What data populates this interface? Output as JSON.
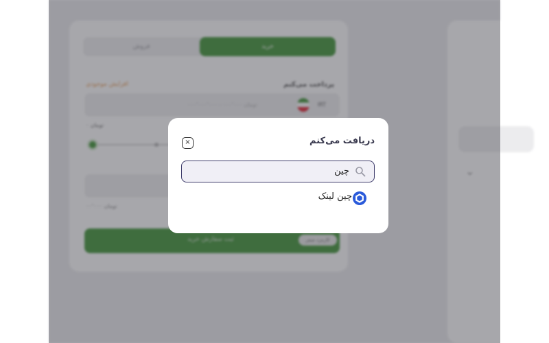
{
  "background": {
    "tabs": {
      "buy": "خرید",
      "sell": "فروش"
    },
    "pay_label": "پرداخت می‌کنم",
    "increase_link": "افزایش موجودی",
    "currency": "IRT",
    "amount_placeholder": "۰۰۰٬۰۰۰٬۰۰۰ - ۰۰۰٬۰۰۰ تومان",
    "unit_label": "۰ تومان",
    "note": "۰۰٬۰۰۰ تومان",
    "submit_label": "ثبت سفارش خرید",
    "badge": "کارمزد صفر"
  },
  "modal": {
    "title": "دریافت می‌کنم",
    "close_symbol": "×",
    "search": {
      "value": "چین",
      "icon": "search-icon"
    },
    "results": [
      {
        "label": "چین لینک",
        "icon": "chainlink-icon",
        "icon_color": "#2a5ada"
      }
    ]
  },
  "colors": {
    "accent_green": "#2e8a24",
    "modal_border": "#3d3b6a",
    "chainlink_blue": "#2a5ada"
  }
}
